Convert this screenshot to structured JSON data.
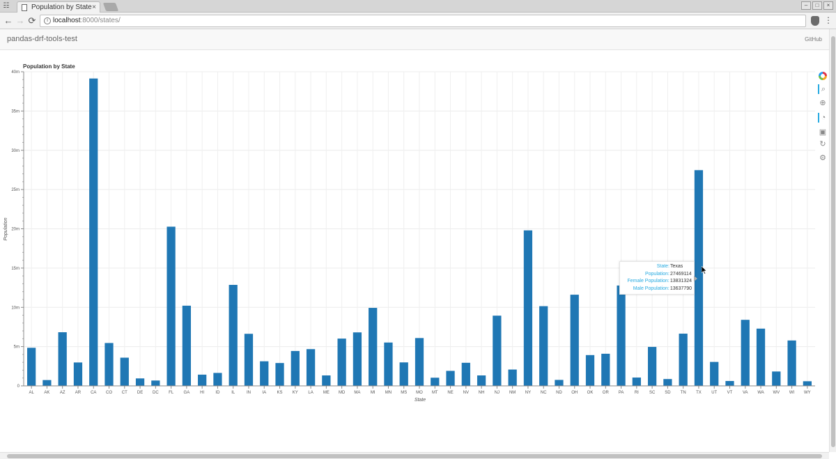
{
  "browser": {
    "tab_title": "Population by State",
    "tab_close": "×",
    "url_host": "localhost",
    "url_path": ":8000/states/",
    "back_icon": "arrow-left-icon",
    "forward_icon": "arrow-right-icon",
    "reload_icon": "reload-icon"
  },
  "navbar": {
    "brand": "pandas-drf-tools-test",
    "github": "GitHub"
  },
  "colors": {
    "bar": "#1f77b4",
    "tooltip_label": "#26aae1"
  },
  "tooltip": {
    "rows": [
      {
        "label": "State:",
        "value": "Texas"
      },
      {
        "label": "Population:",
        "value": "27469114"
      },
      {
        "label": "Female Population:",
        "value": "13831324"
      },
      {
        "label": "Male Population:",
        "value": "13637790"
      }
    ]
  },
  "chart_data": {
    "type": "bar",
    "title": "Population by State",
    "xlabel": "State",
    "ylabel": "Population",
    "ylim": [
      0,
      40000000
    ],
    "y_ticks": [
      0,
      5000000,
      10000000,
      15000000,
      20000000,
      25000000,
      30000000,
      35000000,
      40000000
    ],
    "y_tick_labels": [
      "0",
      "5m",
      "10m",
      "15m",
      "20m",
      "25m",
      "30m",
      "35m",
      "40m"
    ],
    "grid": true,
    "categories": [
      "AL",
      "AK",
      "AZ",
      "AR",
      "CA",
      "CO",
      "CT",
      "DE",
      "DC",
      "FL",
      "GA",
      "HI",
      "ID",
      "IL",
      "IN",
      "IA",
      "KS",
      "KY",
      "LA",
      "ME",
      "MD",
      "MA",
      "MI",
      "MN",
      "MS",
      "MO",
      "MT",
      "NE",
      "NV",
      "NH",
      "NJ",
      "NM",
      "NY",
      "NC",
      "ND",
      "OH",
      "OK",
      "OR",
      "PA",
      "RI",
      "SC",
      "SD",
      "TN",
      "TX",
      "UT",
      "VT",
      "VA",
      "WA",
      "WV",
      "WI",
      "WY"
    ],
    "values": [
      4850000,
      740000,
      6830000,
      2980000,
      39140000,
      5460000,
      3590000,
      950000,
      680000,
      20270000,
      10210000,
      1430000,
      1650000,
      12860000,
      6630000,
      3130000,
      2910000,
      4440000,
      4680000,
      1330000,
      6020000,
      6810000,
      9930000,
      5520000,
      2990000,
      6090000,
      1040000,
      1910000,
      2940000,
      1330000,
      8940000,
      2080000,
      19800000,
      10150000,
      760000,
      11610000,
      3920000,
      4090000,
      12780000,
      1060000,
      4960000,
      870000,
      6650000,
      27469114,
      3050000,
      620000,
      8410000,
      7290000,
      1830000,
      5780000,
      590000
    ]
  },
  "bokeh_tools": [
    {
      "name": "bokeh-logo-icon"
    },
    {
      "name": "box-zoom-icon",
      "active": true
    },
    {
      "name": "wheel-zoom-icon"
    },
    {
      "name": "hover-icon",
      "active": true
    },
    {
      "name": "save-icon"
    },
    {
      "name": "reset-icon"
    },
    {
      "name": "help-icon"
    }
  ]
}
